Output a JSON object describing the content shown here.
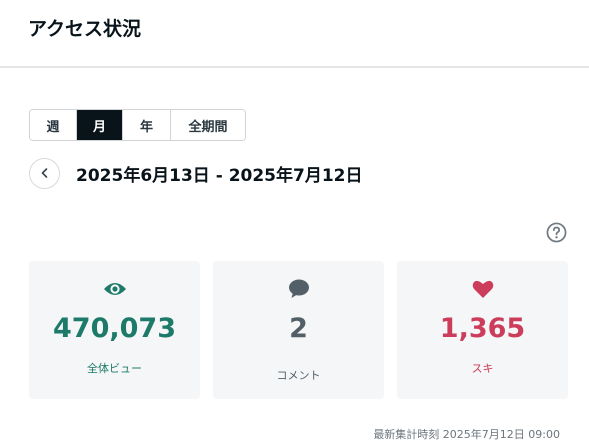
{
  "page": {
    "title": "アクセス状況"
  },
  "period_tabs": [
    {
      "label": "週",
      "active": false
    },
    {
      "label": "月",
      "active": true
    },
    {
      "label": "年",
      "active": false
    },
    {
      "label": "全期間",
      "active": false
    }
  ],
  "date_range": {
    "text": "2025年6月13日 - 2025年7月12日",
    "prev_icon": "chevron-left-icon"
  },
  "help": {
    "icon": "question-circle-icon"
  },
  "stats": {
    "views": {
      "value": "470,073",
      "label": "全体ビュー",
      "icon": "eye-icon",
      "color": "#1d7a68"
    },
    "comments": {
      "value": "2",
      "label": "コメント",
      "icon": "speech-bubble-icon",
      "color": "#535f66"
    },
    "likes": {
      "value": "1,365",
      "label": "スキ",
      "icon": "heart-icon",
      "color": "#cc3d5b"
    }
  },
  "footer": {
    "updated": "最新集計時刻 2025年7月12日 09:00"
  }
}
